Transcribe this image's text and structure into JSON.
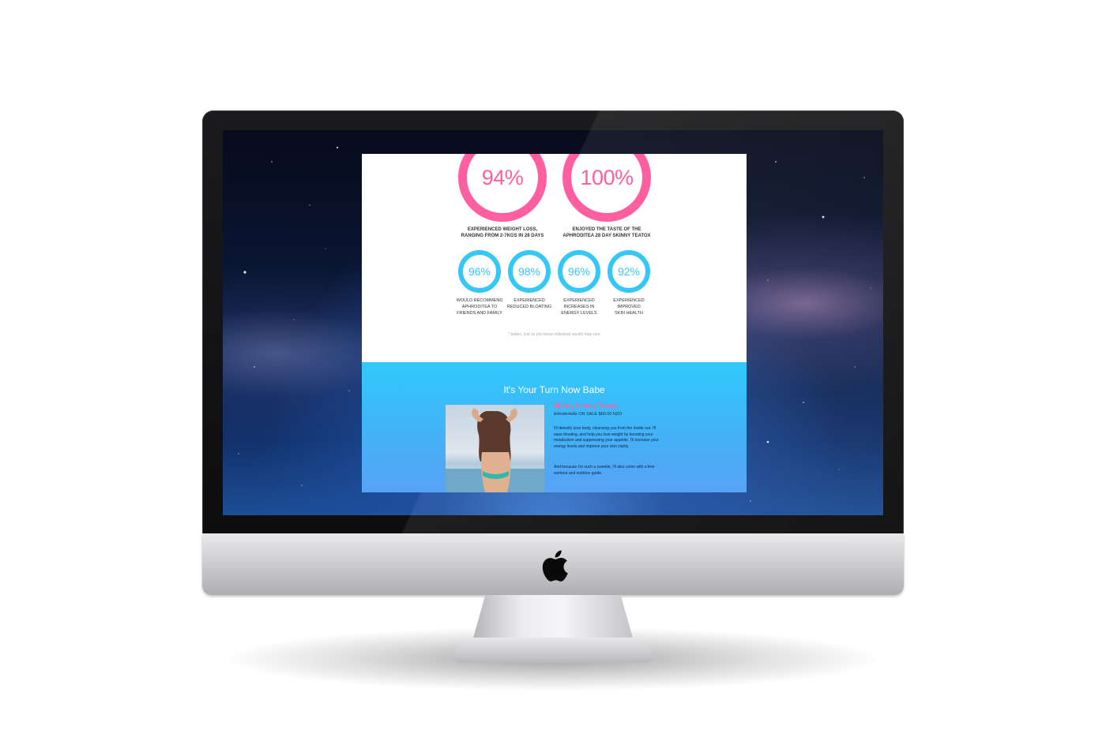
{
  "stats": {
    "big": [
      {
        "value": "94%",
        "caption_line1": "Experienced weight loss,",
        "caption_line2": "ranging from 2-7kgs in 28 days"
      },
      {
        "value": "100%",
        "caption_line1": "Enjoyed the taste of the",
        "caption_line2": "Aphroditea 28 day skinny teatox"
      }
    ],
    "small": [
      {
        "value": "96%",
        "caption": [
          "Would recommend",
          "Aphroditea to",
          "friends and family"
        ]
      },
      {
        "value": "98%",
        "caption": [
          "Experienced",
          "reduced bloating",
          ""
        ]
      },
      {
        "value": "96%",
        "caption": [
          "Experienced",
          "increases in",
          "energy levels"
        ]
      },
      {
        "value": "92%",
        "caption": [
          "Experienced",
          "improved",
          "skin health"
        ]
      }
    ],
    "disclaimer": "* babes, just so you know individual results may vary"
  },
  "cta": {
    "title": "It's Your Turn Now Babe",
    "product_title": "28 Day Skinny Teatox",
    "price_old": "$70.00 NZD",
    "price_sale": "ON SALE $60.00 NZD",
    "paragraph1": "I'll detoxify your body, cleansing you from the inside out. I'll ease bloating, and help you lose weight by boosting your metabolism and suppressing your appetite. I'll increase your energy levels and improve your skin clarity.",
    "paragraph2": "And because I'm such a sweetie, I'll also come with a free workout and nutrition guide."
  },
  "colors": {
    "pink": "#ff5fa0",
    "cyan": "#35c7f5",
    "cta_top": "#31c9fb",
    "cta_bottom": "#58a2f5"
  },
  "icons": {
    "device_logo": "apple-icon"
  }
}
